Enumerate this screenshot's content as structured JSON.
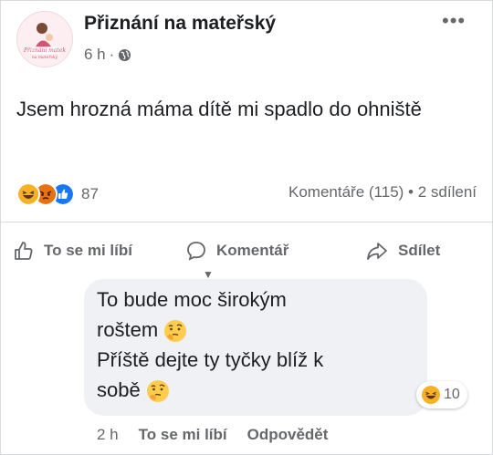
{
  "post": {
    "page_name": "Přiznání na mateřský",
    "time": "6 h",
    "separator": "·",
    "text": "Jsem hrozná máma dítě mi spadlo do ohniště",
    "avatar_logo_text": "Přiznání matek na mateřský"
  },
  "reactions": {
    "types": [
      "haha",
      "angry",
      "like"
    ],
    "count": "87",
    "comments": "Komentáře (115)",
    "dot": "•",
    "shares": "2 sdílení",
    "colors": {
      "haha": "#f7b125",
      "angry": "#e9710f",
      "like": "#1877f2"
    }
  },
  "actions": {
    "like": "To se mi líbí",
    "comment": "Komentář",
    "share": "Sdílet"
  },
  "comment": {
    "line1": "To bude moc širokým",
    "line2": "roštem",
    "line3": "Příště dejte ty tyčky blíž k",
    "line4": "sobě",
    "reaction_count": "10",
    "time": "2 h",
    "like": "To se mi líbí",
    "reply": "Odpovědět"
  }
}
